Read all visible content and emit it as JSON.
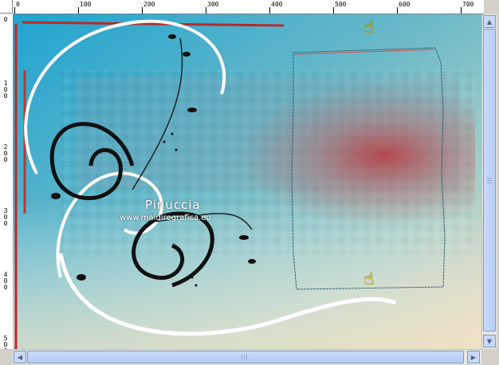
{
  "ruler": {
    "top_labels": [
      "0",
      "100",
      "200",
      "300",
      "400",
      "500",
      "600",
      "700"
    ],
    "left_labels": [
      "0",
      "1\n0\n0",
      "2\n0\n0",
      "3\n0\n0",
      "4\n0\n0",
      "5\n0\n0"
    ]
  },
  "watermark": {
    "title": "Pinuccia",
    "url": "www.maidiregrafica.eu"
  },
  "icons": {
    "hand_top": "pointing-hand-icon",
    "hand_bottom": "pointing-hand-icon"
  },
  "colors": {
    "sky": "#2aa7c8",
    "red_accent": "#c02525",
    "selection_outline": "#2f5f70"
  }
}
